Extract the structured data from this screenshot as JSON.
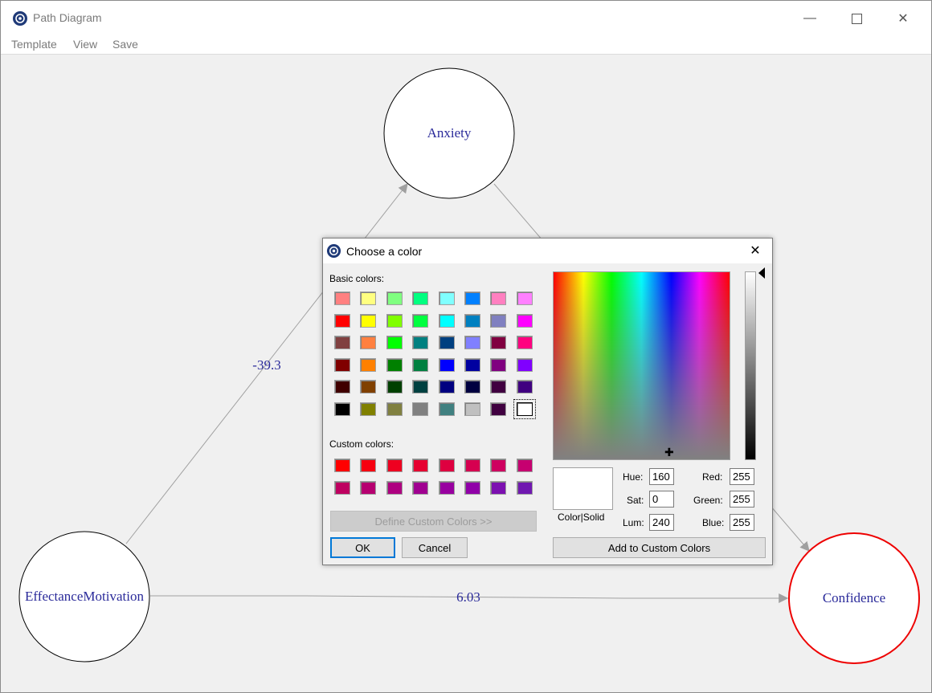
{
  "window": {
    "title": "Path Diagram",
    "minimize_icon": "minimize-icon",
    "maximize_icon": "maximize-icon",
    "close_icon": "close-icon"
  },
  "menu": [
    "Template",
    "View",
    "Save"
  ],
  "diagram": {
    "nodes": [
      {
        "label": "Anxiety",
        "border_color": "#000000"
      },
      {
        "label": "EffectanceMotivation",
        "border_color": "#000000"
      },
      {
        "label": "Confidence",
        "border_color": "#ee0000"
      }
    ],
    "edges": [
      {
        "from": "EffectanceMotivation",
        "to": "Anxiety",
        "label": "-39.3"
      },
      {
        "from": "EffectanceMotivation",
        "to": "Confidence",
        "label": "6.03"
      },
      {
        "from": "Anxiety",
        "to": "Confidence",
        "label": ""
      }
    ],
    "node_text_color": "#2a2a9a",
    "edge_color": "#a0a0a0"
  },
  "dialog": {
    "title": "Choose a color",
    "basic_colors_label": "Basic colors:",
    "custom_colors_label": "Custom colors:",
    "basic_colors": [
      [
        "#ff8080",
        "#ffff80",
        "#80ff80",
        "#00ff80",
        "#80ffff",
        "#0080ff",
        "#ff80c0",
        "#ff80ff"
      ],
      [
        "#ff0000",
        "#ffff00",
        "#80ff00",
        "#00ff40",
        "#00ffff",
        "#0080c0",
        "#8080c0",
        "#ff00ff"
      ],
      [
        "#804040",
        "#ff8040",
        "#00ff00",
        "#008080",
        "#004080",
        "#8080ff",
        "#800040",
        "#ff0080"
      ],
      [
        "#800000",
        "#ff8000",
        "#008000",
        "#008040",
        "#0000ff",
        "#0000a0",
        "#800080",
        "#8000ff"
      ],
      [
        "#400000",
        "#804000",
        "#004000",
        "#004040",
        "#000080",
        "#000040",
        "#400040",
        "#400080"
      ],
      [
        "#000000",
        "#808000",
        "#808040",
        "#808080",
        "#408080",
        "#c0c0c0",
        "#400040",
        "#ffffff"
      ]
    ],
    "selected_basic": "#ffffff",
    "custom_colors": [
      [
        "#ff0000",
        "#f60010",
        "#ee0020",
        "#e60030",
        "#de0040",
        "#d60050",
        "#ce0060",
        "#c60070"
      ],
      [
        "#be0060",
        "#b60070",
        "#ae0080",
        "#a00090",
        "#9800a0",
        "#9000a8",
        "#7c10b0",
        "#7018b0"
      ]
    ],
    "define_custom_button": "Define Custom Colors >>",
    "ok_button": "OK",
    "cancel_button": "Cancel",
    "color_solid_label": "Color|Solid",
    "hue_label": "Hue:",
    "hue_value": "160",
    "sat_label": "Sat:",
    "sat_value": "0",
    "lum_label": "Lum:",
    "lum_value": "240",
    "red_label": "Red:",
    "red_value": "255",
    "green_label": "Green:",
    "green_value": "255",
    "blue_label": "Blue:",
    "blue_value": "255",
    "add_custom_button": "Add to Custom Colors"
  }
}
